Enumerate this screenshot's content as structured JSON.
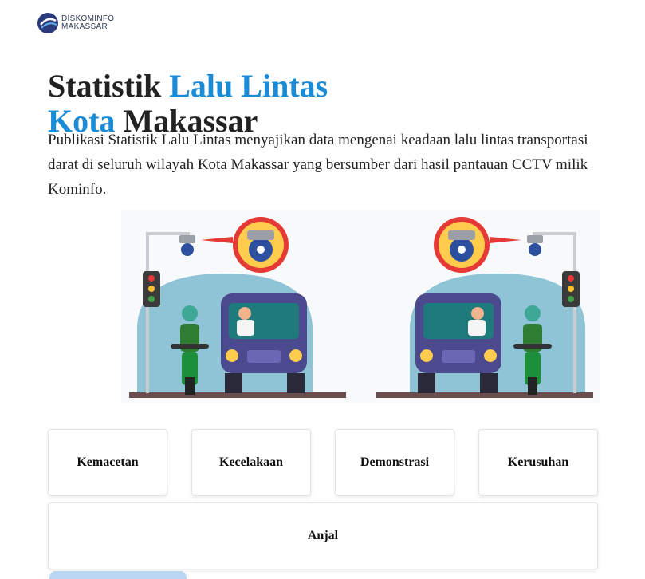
{
  "brand": {
    "line1": "DISKOMINFO",
    "line2": "MAKASSAR"
  },
  "hero": {
    "title_part1": "Statistik ",
    "title_part2": "Lalu Lintas",
    "title_part3": "Kota",
    "title_part4": " Makassar",
    "description": "Publikasi Statistik Lalu Lintas menyajikan data mengenai keadaan lalu lintas transportasi darat di seluruh wilayah Kota Makassar yang bersumber dari hasil pantauan CCTV milik Kominfo."
  },
  "categories": [
    {
      "label": "Kemacetan"
    },
    {
      "label": "Kecelakaan"
    },
    {
      "label": "Demonstrasi"
    },
    {
      "label": "Kerusuhan"
    },
    {
      "label": "Anjal"
    }
  ],
  "colors": {
    "accent": "#1a8bd6",
    "illustration_bg": "#8fc3d6",
    "car": "#4c4a8e",
    "road": "#6b4d4d"
  }
}
